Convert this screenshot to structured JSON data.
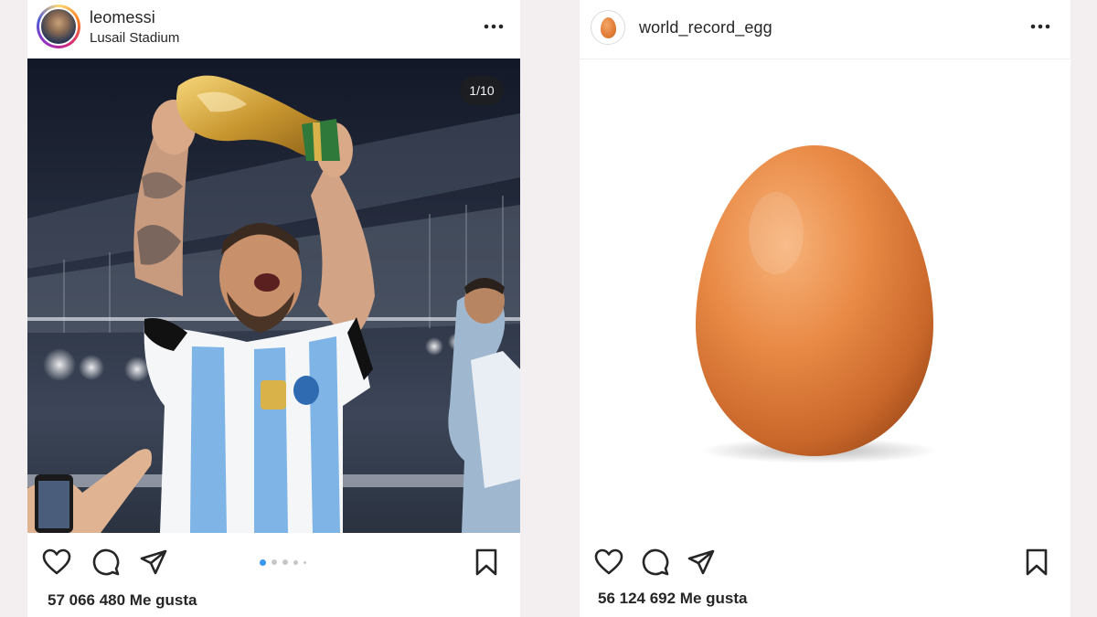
{
  "posts": [
    {
      "username": "leomessi",
      "location": "Lusail Stadium",
      "media_counter": "1/10",
      "carousel": {
        "total": 5,
        "active": 1
      },
      "likes": "57 066 480 Me gusta",
      "image": "messi-trophy-photo"
    },
    {
      "username": "world_record_egg",
      "likes": "56 124 692 Me gusta",
      "image": "brown-egg-photo"
    }
  ],
  "icons": [
    "more-icon",
    "heart-icon",
    "comment-icon",
    "share-icon",
    "bookmark-icon"
  ],
  "colors": {
    "background": "#f3eff0",
    "card": "#ffffff",
    "text": "#262626",
    "carousel_active": "#3897f0",
    "carousel_inactive": "#c7c7c7"
  }
}
